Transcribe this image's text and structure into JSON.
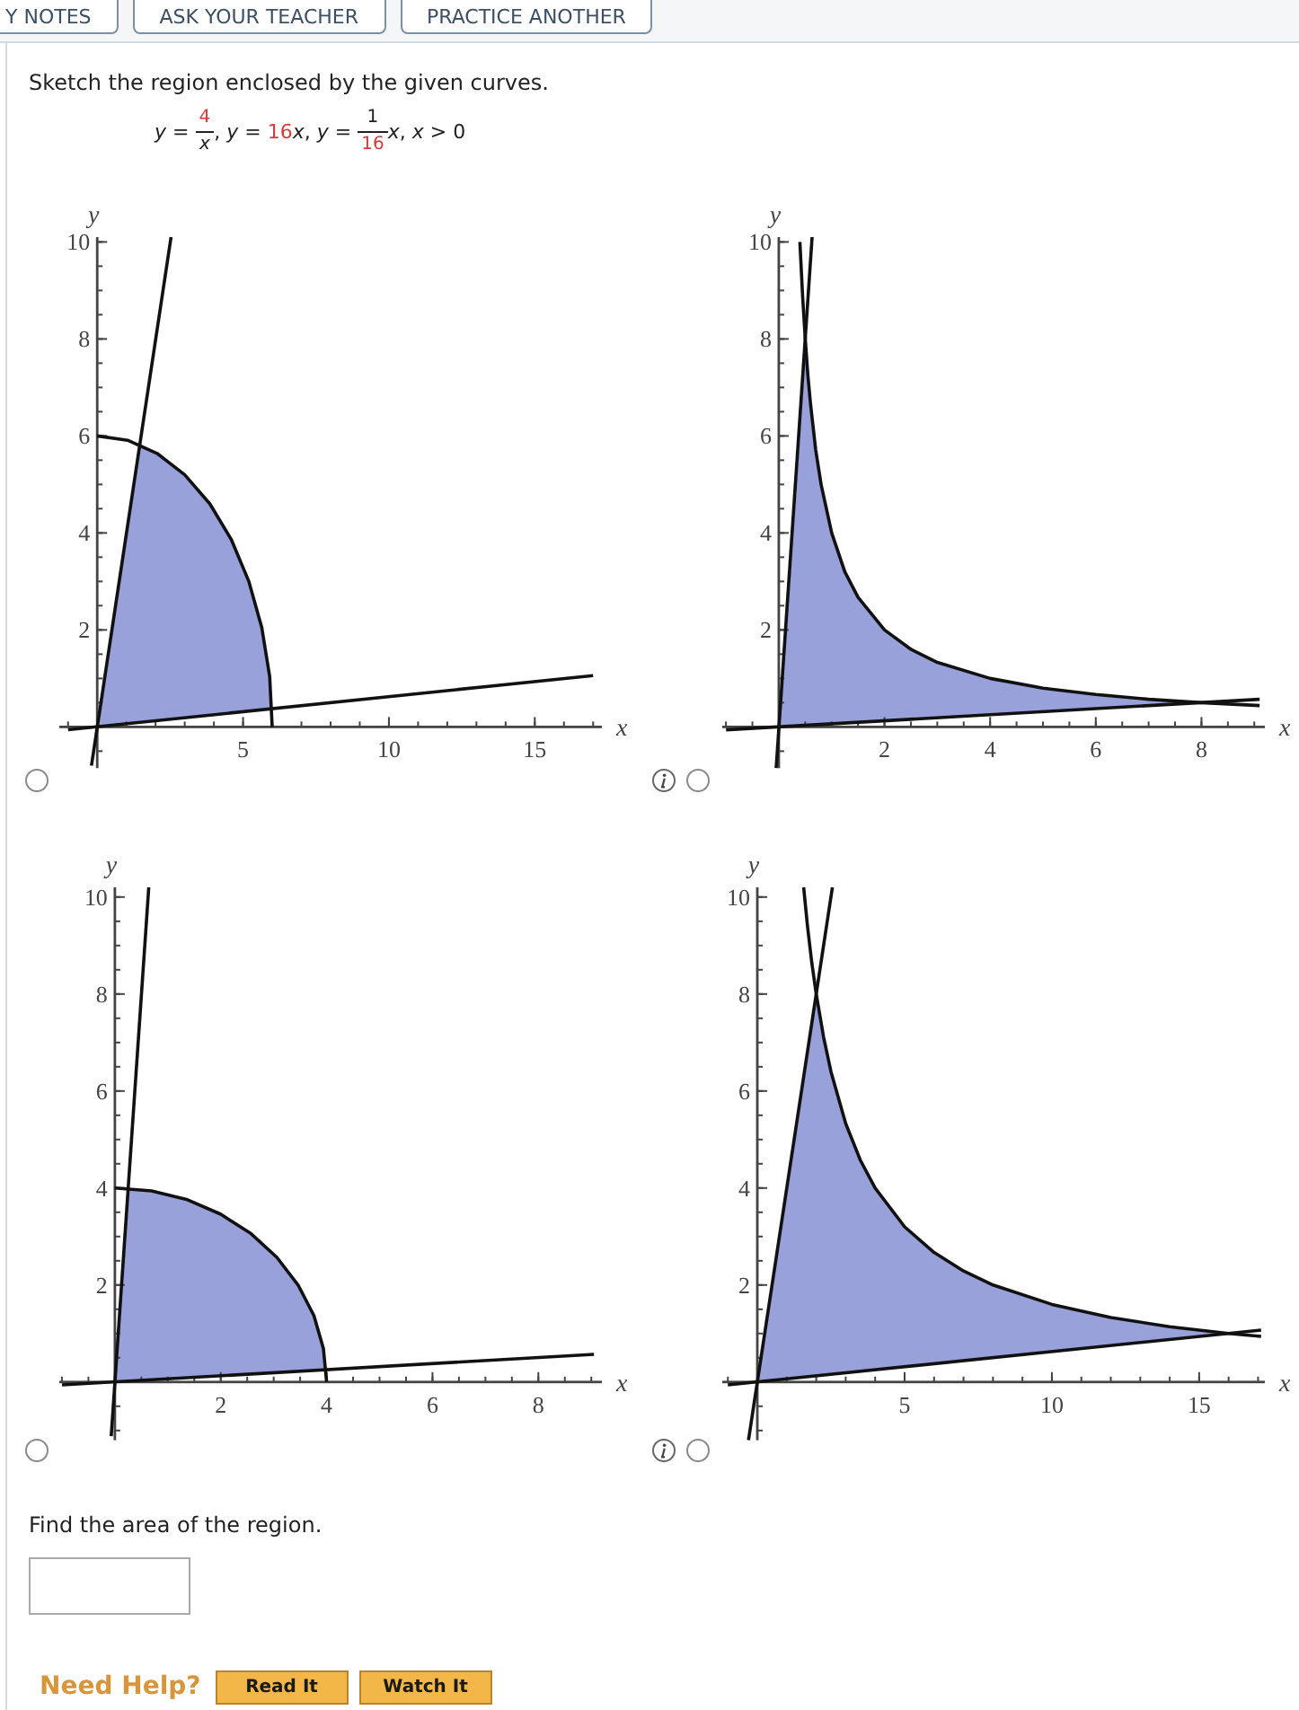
{
  "toolbar_buttons": [
    "Y NOTES",
    "ASK YOUR TEACHER",
    "PRACTICE ANOTHER"
  ],
  "question": {
    "prompt": "Sketch the region enclosed by the given curves.",
    "equation": [
      {
        "kind": "text",
        "text": "*y* = ",
        "highlighted": false
      },
      {
        "kind": "fraction",
        "numerator": {
          "text": "4",
          "highlighted": true
        },
        "denominator": {
          "text": "*x*",
          "highlighted": false
        }
      },
      {
        "kind": "text",
        "text": ", *y* = ",
        "highlighted": false
      },
      {
        "kind": "text",
        "text": "16",
        "highlighted": true
      },
      {
        "kind": "text",
        "text": "*x*, *y* = ",
        "highlighted": false
      },
      {
        "kind": "fraction",
        "numerator": {
          "text": "1",
          "highlighted": false
        },
        "denominator": {
          "text": "16",
          "highlighted": true
        }
      },
      {
        "kind": "text",
        "text": "*x*, *x* > 0",
        "highlighted": false
      }
    ]
  },
  "options": [
    {
      "selected": false,
      "info_link": true,
      "chart_data": {
        "type": "line",
        "xlabel": "x",
        "ylabel": "y",
        "xlim": [
          -1.3,
          17.3
        ],
        "ylim": [
          -0.85,
          10.1
        ],
        "xticks": [
          5,
          10,
          15
        ],
        "yticks": [
          2,
          4,
          6,
          8,
          10
        ],
        "series": [
          {
            "color": "#111111",
            "x": [
              0,
              1.04,
              2.05,
              3,
              3.86,
              4.6,
              5.2,
              5.64,
              5.91,
              6
            ],
            "values": [
              6,
              5.91,
              5.64,
              5.2,
              4.6,
              3.86,
              3,
              2.05,
              1.04,
              0
            ]
          },
          {
            "color": "#111111",
            "x": [
              -0.2,
              2.53
            ],
            "values": [
              -0.8,
              10.1
            ]
          },
          {
            "color": "#111111",
            "x": [
              -1,
              17
            ],
            "values": [
              -0.06,
              1.06
            ]
          }
        ]
      }
    },
    {
      "selected": false,
      "info_link": false,
      "chart_data": {
        "type": "line",
        "xlabel": "x",
        "ylabel": "y",
        "xlim": [
          -1.07,
          9.2
        ],
        "ylim": [
          -0.85,
          10.1
        ],
        "xticks": [
          2,
          4,
          6,
          8
        ],
        "yticks": [
          2,
          4,
          6,
          8,
          10
        ],
        "series": [
          {
            "color": "#111111",
            "x": [
              0.4,
              0.45,
              0.5,
              0.55,
              0.6,
              0.7,
              0.8,
              1,
              1.25,
              1.5,
              2,
              2.5,
              3,
              4,
              5,
              6,
              7,
              8,
              9.1
            ],
            "values": [
              10,
              8.89,
              8,
              7.27,
              6.67,
              5.71,
              5,
              4,
              3.2,
              2.67,
              2,
              1.6,
              1.33,
              1,
              0.8,
              0.67,
              0.57,
              0.5,
              0.44
            ]
          },
          {
            "color": "#111111",
            "x": [
              -0.05,
              0.63
            ],
            "values": [
              -0.85,
              10.1
            ]
          },
          {
            "color": "#111111",
            "x": [
              -1,
              9.1
            ],
            "values": [
              -0.06,
              0.57
            ]
          }
        ]
      }
    },
    {
      "selected": false,
      "info_link": true,
      "chart_data": {
        "type": "line",
        "xlabel": "x",
        "ylabel": "y",
        "xlim": [
          -1.05,
          9.2
        ],
        "ylim": [
          -1.2,
          10.2
        ],
        "xticks": [
          2,
          4,
          6,
          8
        ],
        "yticks": [
          2,
          4,
          6,
          8,
          10
        ],
        "series": [
          {
            "color": "#111111",
            "x": [
              0,
              0.69,
              1.37,
              2,
              2.57,
              3.06,
              3.46,
              3.76,
              3.94,
              4
            ],
            "values": [
              4,
              3.94,
              3.76,
              3.46,
              3.06,
              2.57,
              2,
              1.37,
              0.69,
              0
            ]
          },
          {
            "color": "#111111",
            "x": [
              -0.07,
              0.64
            ],
            "values": [
              -1.12,
              10.2
            ]
          },
          {
            "color": "#111111",
            "x": [
              -1,
              9.05
            ],
            "values": [
              -0.06,
              0.57
            ]
          }
        ]
      }
    },
    {
      "selected": false,
      "info_link": false,
      "chart_data": {
        "type": "line",
        "xlabel": "x",
        "ylabel": "y",
        "xlim": [
          -1.19,
          17.23
        ],
        "ylim": [
          -1.2,
          10.2
        ],
        "xticks": [
          5,
          10,
          15
        ],
        "yticks": [
          2,
          4,
          6,
          8,
          10
        ],
        "series": [
          {
            "color": "#111111",
            "x": [
              1.57,
              1.7,
              1.85,
              2,
              2.25,
              2.5,
              3,
              3.5,
              4,
              5,
              6,
              7,
              8,
              10,
              12,
              14,
              16,
              17.1
            ],
            "values": [
              10.2,
              9.41,
              8.65,
              8,
              7.11,
              6.4,
              5.33,
              4.57,
              4,
              3.2,
              2.67,
              2.29,
              2,
              1.6,
              1.33,
              1.14,
              1,
              0.94
            ]
          },
          {
            "color": "#111111",
            "x": [
              -0.3,
              2.55
            ],
            "values": [
              -1.2,
              10.2
            ]
          },
          {
            "color": "#111111",
            "x": [
              -1,
              17.1
            ],
            "values": [
              -0.06,
              1.07
            ]
          }
        ]
      }
    }
  ],
  "area_question": {
    "prompt": "Find the area of the region."
  },
  "help": {
    "label": "Need Help?",
    "buttons": [
      "Read It",
      "Watch It"
    ]
  }
}
